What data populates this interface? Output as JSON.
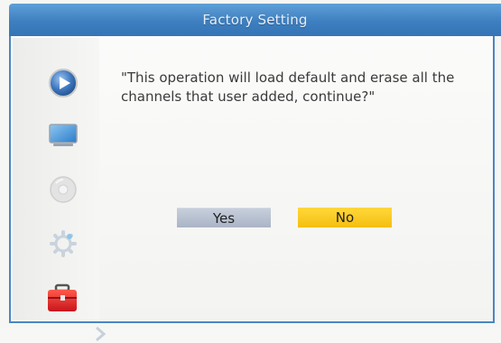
{
  "window": {
    "title": "Factory Setting"
  },
  "sidebar": {
    "items": [
      {
        "icon": "play-icon"
      },
      {
        "icon": "monitor-icon"
      },
      {
        "icon": "disc-icon"
      },
      {
        "icon": "gear-icon"
      },
      {
        "icon": "toolbox-icon",
        "selected": true
      }
    ]
  },
  "dialog": {
    "message": "\"This operation will load default and erase all the channels that user added, continue?\"",
    "yes_label": "Yes",
    "no_label": "No"
  },
  "colors": {
    "title_bar": "#3d7fc0",
    "selected_button": "#f5c415",
    "unselected_button": "#b3bccb"
  }
}
